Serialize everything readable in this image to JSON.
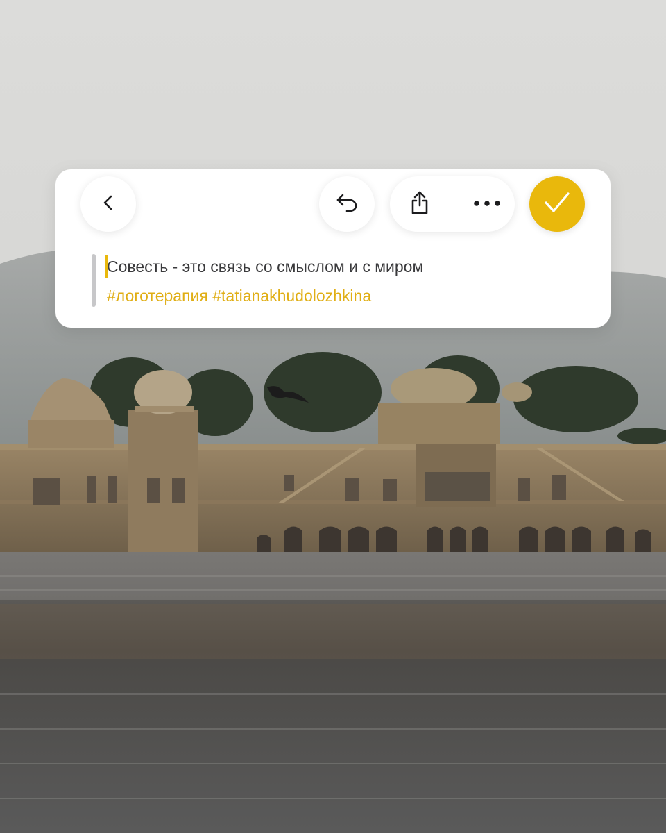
{
  "toolbar": {
    "back_icon": "chevron-left-icon",
    "undo_icon": "undo-icon",
    "share_icon": "share-icon",
    "more_icon": "more-horizontal-icon",
    "done_icon": "checkmark-icon"
  },
  "note": {
    "text": "Совесть - это связь со смыслом и с миром",
    "hashtags": "#логотерапия #tatianakhudolozhkina"
  },
  "colors": {
    "accent": "#E9B80C",
    "hashtag": "#E0AE14",
    "text": "#3a3a3c",
    "card": "#ffffff",
    "sky": "#d9d9d7",
    "water": "#4a4a4b"
  }
}
